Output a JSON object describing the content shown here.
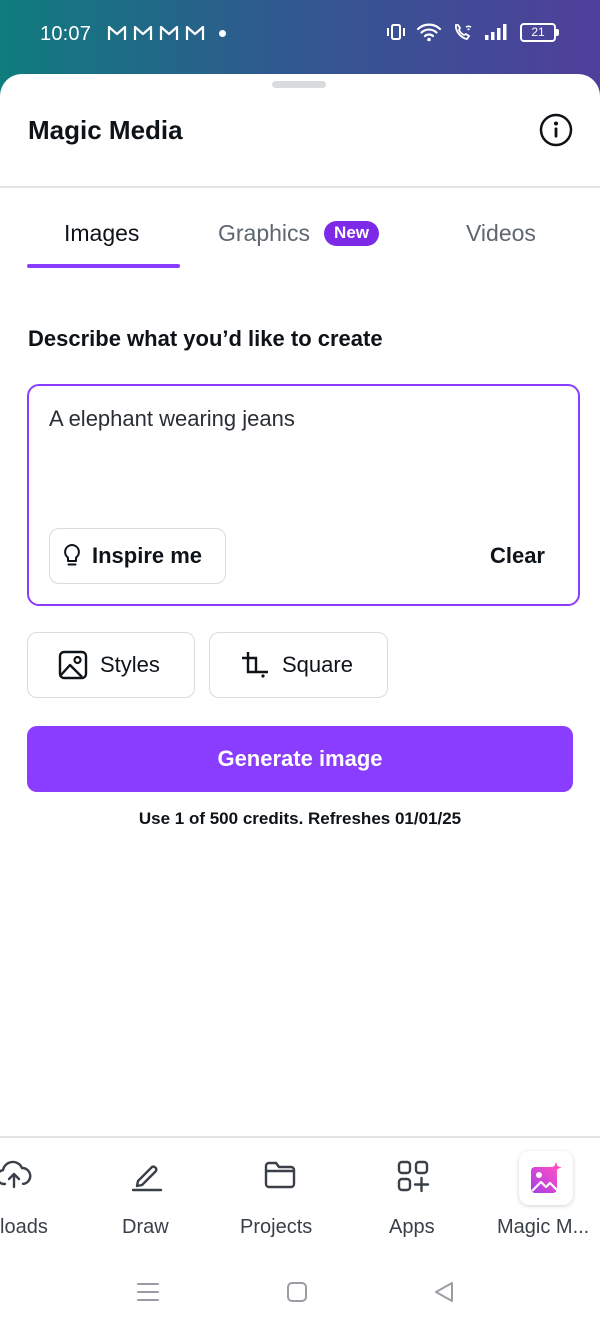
{
  "status_bar": {
    "time": "10:07",
    "battery": "21",
    "notification_icons": [
      "gmail-icon",
      "gmail-icon",
      "gmail-icon",
      "gmail-icon"
    ]
  },
  "header": {
    "title": "Magic Media",
    "info_icon": "info-icon"
  },
  "tabs": [
    {
      "label": "Images",
      "active": true
    },
    {
      "label": "Graphics",
      "badge": "New",
      "active": false
    },
    {
      "label": "Videos",
      "active": false
    }
  ],
  "prompt": {
    "label": "Describe what you’d like to create",
    "value": "A elephant wearing jeans",
    "inspire_label": "Inspire me",
    "clear_label": "Clear"
  },
  "options": {
    "styles_label": "Styles",
    "aspect_label": "Square"
  },
  "generate": {
    "label": "Generate image",
    "credits": "Use 1 of 500 credits. Refreshes 01/01/25"
  },
  "bottom_nav": [
    {
      "label": "loads",
      "icon": "cloud-upload-icon"
    },
    {
      "label": "Draw",
      "icon": "pen-icon"
    },
    {
      "label": "Projects",
      "icon": "folder-icon"
    },
    {
      "label": "Apps",
      "icon": "apps-grid-icon"
    },
    {
      "label": "Magic M...",
      "icon": "magic-media-icon"
    }
  ],
  "colors": {
    "accent": "#8b3dff",
    "badge": "#7d2ae8",
    "text": "#0e1318"
  }
}
